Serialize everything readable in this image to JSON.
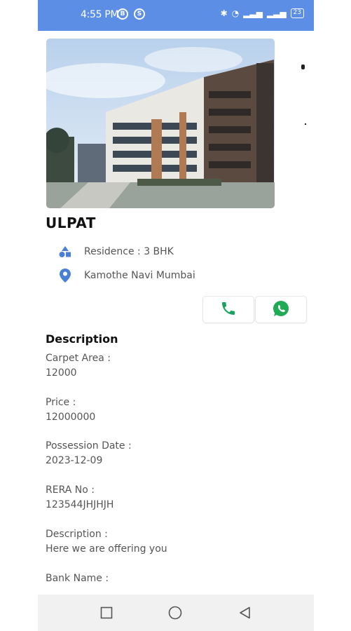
{
  "status_bar": {
    "time": "4:55 PM",
    "battery": "23"
  },
  "property": {
    "title": "ULPAT",
    "residence": "Residence : 3 BHK",
    "location": "Kamothe Navi Mumbai"
  },
  "description": {
    "heading": "Description",
    "fields": [
      {
        "label": "Carpet Area :",
        "value": "12000"
      },
      {
        "label": "Price :",
        "value": "12000000"
      },
      {
        "label": "Possession Date :",
        "value": "2023-12-09"
      },
      {
        "label": "RERA No :",
        "value": "123544JHJHJH"
      },
      {
        "label": "Description :",
        "value": "Here we are offering you"
      },
      {
        "label": "Bank Name :",
        "value": ""
      }
    ]
  },
  "colors": {
    "status_bar": "#5b8ee4",
    "icon_blue": "#4a7fd6",
    "call_green": "#1aa260",
    "whatsapp_green": "#1faa53"
  },
  "icons": [
    "residence-icon",
    "location-pin-icon",
    "phone-icon",
    "whatsapp-icon"
  ]
}
